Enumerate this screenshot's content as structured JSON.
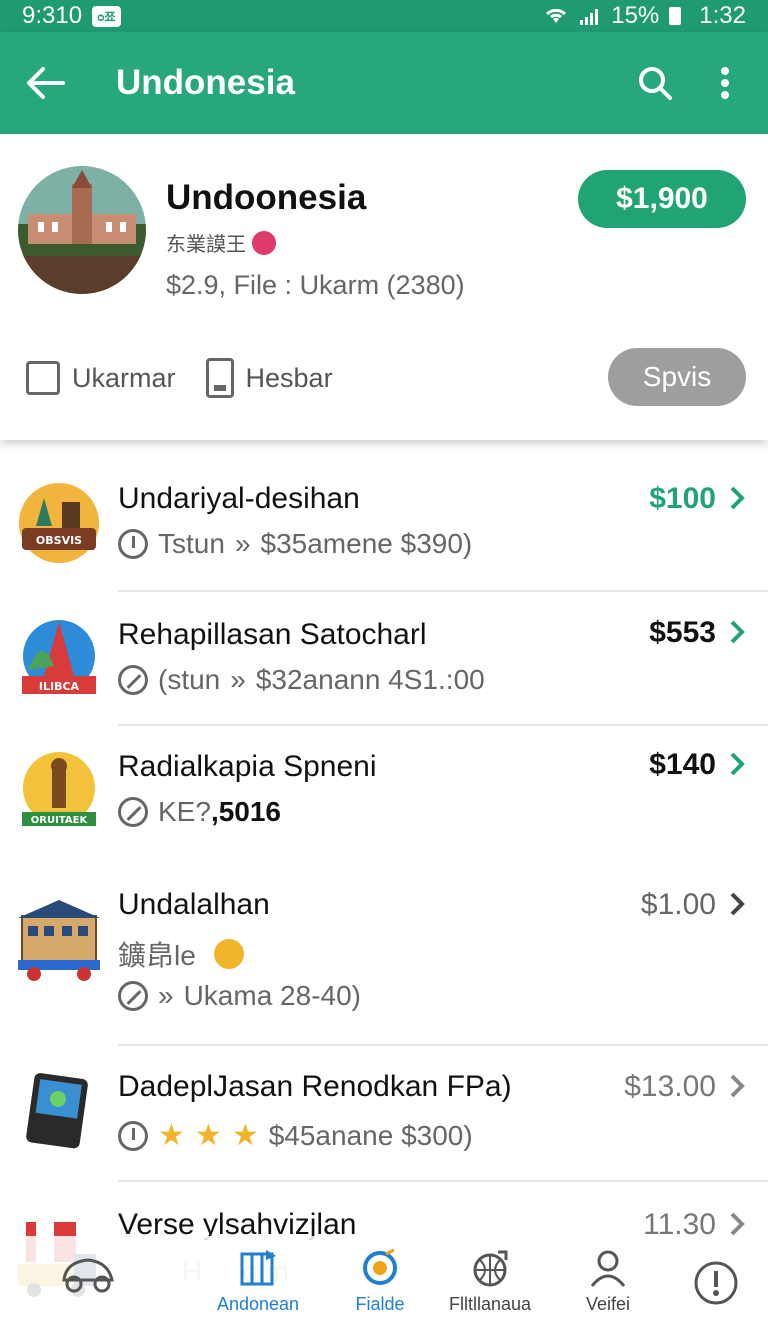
{
  "statusbar": {
    "time_left": "9:310",
    "badge": "ᴑ쬬",
    "battery": "15%",
    "time_right": "1:32"
  },
  "appbar": {
    "title": "Undonesia",
    "icons": [
      "arrow-back-icon",
      "search-icon",
      "more-vert-icon"
    ]
  },
  "profile": {
    "name": "Undoonesia",
    "subtitle": "东業謨王",
    "info": "$2.9, File : Ukarm (2380)",
    "price": "$1,900",
    "option1": "Ukarmar",
    "option2": "Hesbar",
    "action_button": "Spvis"
  },
  "items": [
    {
      "name": "Undariyal-desihan",
      "meta1": "Tstun",
      "meta2": "$35amene $390)",
      "price": "$100",
      "price_color": "#21a474",
      "thumb_label": "OBSVIS"
    },
    {
      "name": "Rehapillasan Satocharl",
      "meta1": "(stun",
      "meta2": "$32anann 4S1.:00",
      "price": "$553",
      "price_color": "#111111",
      "thumb_label": "ILIBCA"
    },
    {
      "name": "Radialkapia Spneni",
      "meta1": "KE?",
      "meta2": ",5016",
      "price": "$140",
      "price_color": "#111111",
      "thumb_label": "ORUITAEK"
    },
    {
      "name": "Undalalhan",
      "sub": "鑛皍le",
      "meta1": "Ukama 28-40)",
      "price": "$1.00",
      "price_color": "#666666"
    },
    {
      "name": "DadeplJasan Renodkan FPa)",
      "meta1": "$45anane $300)",
      "price": "$13.00",
      "price_color": "#777777",
      "rating": 3
    },
    {
      "name": "Verse ylsahvizjlan",
      "meta1": "H",
      "meta2": "gnn",
      "price": "11.30",
      "price_color": "#777777"
    }
  ],
  "bottomnav": {
    "items": [
      {
        "label": "",
        "icon": "car-icon"
      },
      {
        "label": "Andonean",
        "icon": "map-flag-icon"
      },
      {
        "label": "Fialde",
        "icon": "target-icon"
      },
      {
        "label": "Flltllanaua",
        "icon": "globe-icon"
      },
      {
        "label": "Veifei",
        "icon": "person-icon"
      },
      {
        "label": "",
        "icon": "info-icon"
      }
    ],
    "active_color": "#1f7fd0"
  }
}
